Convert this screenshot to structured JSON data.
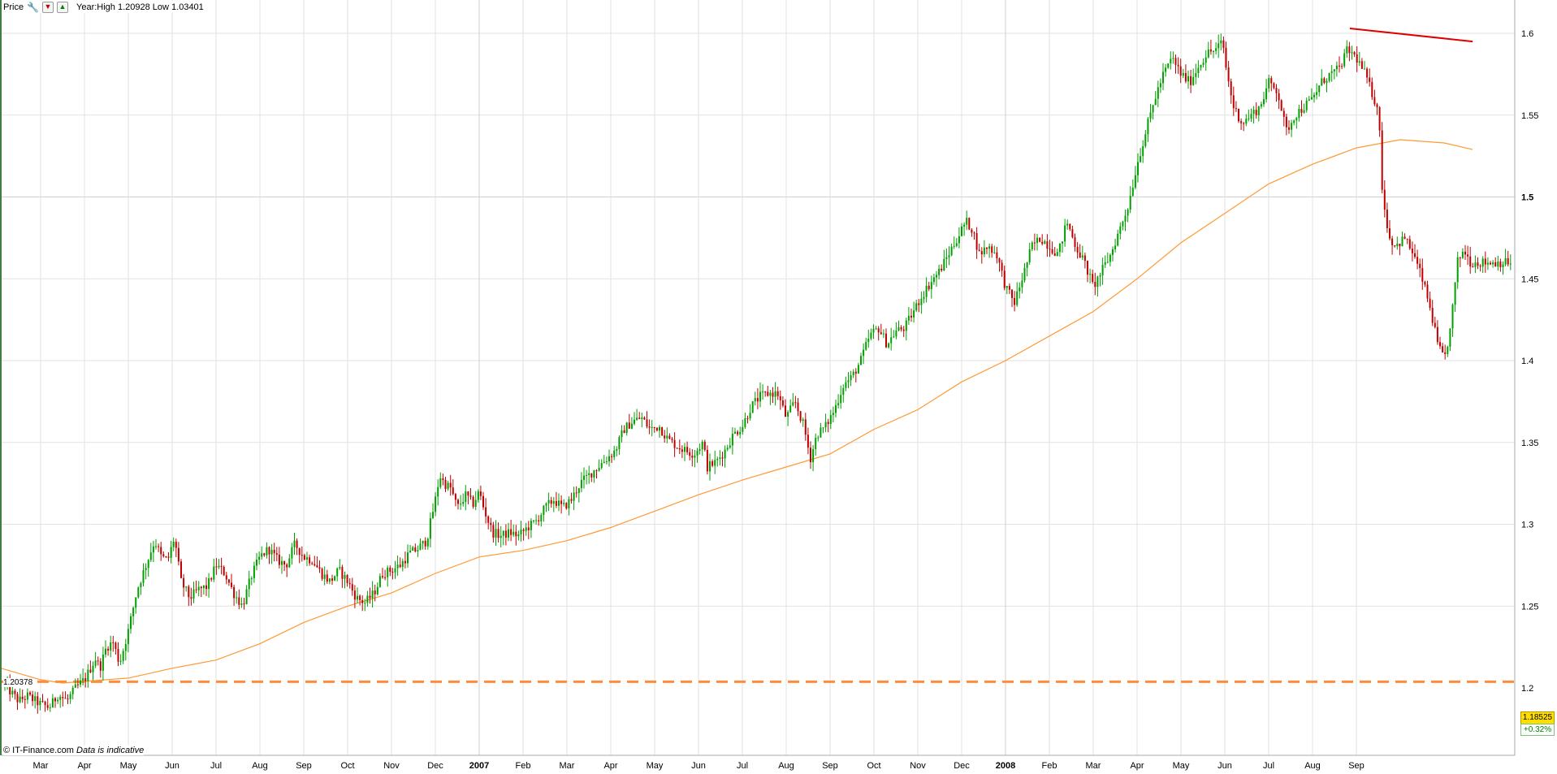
{
  "toolbar": {
    "price_label": "Price",
    "year_range": "Year:High 1.20928 Low 1.03401"
  },
  "icons": [
    "wrench-icon",
    "arrow-down-icon",
    "arrow-up-icon"
  ],
  "footer": {
    "source": "© IT-Finance.com",
    "disclaimer": "Data is indicative"
  },
  "price_box": {
    "last": "1.18525",
    "change": "+0.32%"
  },
  "level_label": "1.20378",
  "colors": {
    "up_candle": "#00a000",
    "down_candle": "#c00000",
    "moving_average": "#ff9933",
    "trendline": "#e00000",
    "support_line": "#ff8c3a",
    "grid": "#e2e2e2"
  },
  "chart_data": {
    "type": "candlestick",
    "title": "",
    "xlabel": "",
    "ylabel": "",
    "ylim": [
      1.18,
      1.62
    ],
    "grid": true,
    "y_ticks": [
      1.25,
      1.3,
      1.35,
      1.4,
      1.45,
      1.5,
      1.55,
      1.6
    ],
    "y_tick_labels": [
      "1.25",
      "1.3",
      "1.35",
      "1.4",
      "1.45",
      "1.5",
      "1.55",
      "1.6"
    ],
    "y_ticks_extra": [
      1.2
    ],
    "y_ticks_extra_labels": [
      "1.2"
    ],
    "x_tick_labels": [
      "Mar",
      "Apr",
      "May",
      "Jun",
      "Jul",
      "Aug",
      "Sep",
      "Oct",
      "Nov",
      "Dec",
      "2007",
      "Feb",
      "Mar",
      "Apr",
      "May",
      "Jun",
      "Jul",
      "Aug",
      "Sep",
      "Oct",
      "Nov",
      "Dec",
      "2008",
      "Feb",
      "Mar",
      "Apr",
      "May",
      "Jun",
      "Jul",
      "Aug",
      "Sep"
    ],
    "x_tick_bold": [
      false,
      false,
      false,
      false,
      false,
      false,
      false,
      false,
      false,
      false,
      true,
      false,
      false,
      false,
      false,
      false,
      false,
      false,
      false,
      false,
      false,
      false,
      true,
      false,
      false,
      false,
      false,
      false,
      false,
      false,
      false
    ],
    "x_tick_months": [
      0,
      1,
      2,
      3,
      4,
      5,
      6,
      7,
      8,
      9,
      10,
      11,
      12,
      13,
      14,
      15,
      16,
      17,
      18,
      19,
      20,
      21,
      22,
      23,
      24,
      25,
      26,
      27,
      28,
      29,
      30
    ],
    "x_range_months": [
      -0.9,
      30.65
    ],
    "price_path": [
      [
        -0.9,
        1.205
      ],
      [
        -0.7,
        1.198
      ],
      [
        -0.5,
        1.192
      ],
      [
        -0.3,
        1.195
      ],
      [
        0.0,
        1.19
      ],
      [
        0.2,
        1.188
      ],
      [
        0.4,
        1.196
      ],
      [
        0.6,
        1.192
      ],
      [
        0.8,
        1.2
      ],
      [
        1.0,
        1.205
      ],
      [
        1.1,
        1.21
      ],
      [
        1.25,
        1.218
      ],
      [
        1.35,
        1.212
      ],
      [
        1.5,
        1.225
      ],
      [
        1.65,
        1.228
      ],
      [
        1.8,
        1.215
      ],
      [
        2.0,
        1.235
      ],
      [
        2.2,
        1.26
      ],
      [
        2.4,
        1.275
      ],
      [
        2.6,
        1.29
      ],
      [
        2.75,
        1.28
      ],
      [
        2.9,
        1.278
      ],
      [
        3.05,
        1.292
      ],
      [
        3.2,
        1.265
      ],
      [
        3.4,
        1.255
      ],
      [
        3.6,
        1.26
      ],
      [
        3.8,
        1.262
      ],
      [
        4.0,
        1.275
      ],
      [
        4.2,
        1.27
      ],
      [
        4.4,
        1.258
      ],
      [
        4.6,
        1.25
      ],
      [
        4.8,
        1.268
      ],
      [
        5.0,
        1.28
      ],
      [
        5.2,
        1.285
      ],
      [
        5.4,
        1.278
      ],
      [
        5.6,
        1.275
      ],
      [
        5.8,
        1.288
      ],
      [
        6.0,
        1.28
      ],
      [
        6.2,
        1.278
      ],
      [
        6.4,
        1.27
      ],
      [
        6.6,
        1.265
      ],
      [
        6.8,
        1.272
      ],
      [
        7.0,
        1.265
      ],
      [
        7.2,
        1.255
      ],
      [
        7.4,
        1.252
      ],
      [
        7.6,
        1.258
      ],
      [
        7.8,
        1.27
      ],
      [
        8.0,
        1.272
      ],
      [
        8.2,
        1.275
      ],
      [
        8.4,
        1.282
      ],
      [
        8.6,
        1.285
      ],
      [
        8.8,
        1.29
      ],
      [
        9.0,
        1.315
      ],
      [
        9.1,
        1.33
      ],
      [
        9.2,
        1.325
      ],
      [
        9.35,
        1.322
      ],
      [
        9.5,
        1.31
      ],
      [
        9.7,
        1.318
      ],
      [
        9.85,
        1.312
      ],
      [
        10.0,
        1.32
      ],
      [
        10.1,
        1.31
      ],
      [
        10.3,
        1.295
      ],
      [
        10.5,
        1.293
      ],
      [
        10.7,
        1.295
      ],
      [
        10.9,
        1.293
      ],
      [
        11.1,
        1.298
      ],
      [
        11.3,
        1.302
      ],
      [
        11.5,
        1.31
      ],
      [
        11.7,
        1.315
      ],
      [
        11.9,
        1.31
      ],
      [
        12.1,
        1.315
      ],
      [
        12.3,
        1.325
      ],
      [
        12.5,
        1.33
      ],
      [
        12.7,
        1.335
      ],
      [
        12.9,
        1.34
      ],
      [
        13.1,
        1.345
      ],
      [
        13.3,
        1.358
      ],
      [
        13.5,
        1.363
      ],
      [
        13.7,
        1.365
      ],
      [
        13.9,
        1.358
      ],
      [
        14.1,
        1.36
      ],
      [
        14.3,
        1.352
      ],
      [
        14.5,
        1.348
      ],
      [
        14.7,
        1.345
      ],
      [
        14.9,
        1.343
      ],
      [
        15.1,
        1.35
      ],
      [
        15.2,
        1.335
      ],
      [
        15.4,
        1.338
      ],
      [
        15.6,
        1.345
      ],
      [
        15.8,
        1.355
      ],
      [
        16.0,
        1.36
      ],
      [
        16.2,
        1.372
      ],
      [
        16.4,
        1.378
      ],
      [
        16.6,
        1.38
      ],
      [
        16.8,
        1.38
      ],
      [
        17.0,
        1.365
      ],
      [
        17.2,
        1.375
      ],
      [
        17.4,
        1.36
      ],
      [
        17.55,
        1.34
      ],
      [
        17.7,
        1.355
      ],
      [
        17.9,
        1.36
      ],
      [
        18.1,
        1.37
      ],
      [
        18.3,
        1.385
      ],
      [
        18.5,
        1.39
      ],
      [
        18.7,
        1.4
      ],
      [
        18.9,
        1.415
      ],
      [
        19.1,
        1.42
      ],
      [
        19.3,
        1.41
      ],
      [
        19.5,
        1.418
      ],
      [
        19.7,
        1.42
      ],
      [
        19.9,
        1.43
      ],
      [
        20.1,
        1.44
      ],
      [
        20.3,
        1.448
      ],
      [
        20.5,
        1.455
      ],
      [
        20.7,
        1.465
      ],
      [
        20.9,
        1.475
      ],
      [
        21.1,
        1.485
      ],
      [
        21.25,
        1.48
      ],
      [
        21.4,
        1.465
      ],
      [
        21.6,
        1.47
      ],
      [
        21.8,
        1.465
      ],
      [
        22.0,
        1.445
      ],
      [
        22.2,
        1.435
      ],
      [
        22.4,
        1.452
      ],
      [
        22.6,
        1.47
      ],
      [
        22.8,
        1.475
      ],
      [
        23.0,
        1.47
      ],
      [
        23.2,
        1.465
      ],
      [
        23.4,
        1.485
      ],
      [
        23.6,
        1.47
      ],
      [
        23.8,
        1.46
      ],
      [
        24.0,
        1.445
      ],
      [
        24.2,
        1.455
      ],
      [
        24.4,
        1.465
      ],
      [
        24.6,
        1.48
      ],
      [
        24.8,
        1.495
      ],
      [
        25.0,
        1.52
      ],
      [
        25.2,
        1.54
      ],
      [
        25.4,
        1.56
      ],
      [
        25.6,
        1.575
      ],
      [
        25.8,
        1.585
      ],
      [
        26.0,
        1.575
      ],
      [
        26.2,
        1.57
      ],
      [
        26.4,
        1.58
      ],
      [
        26.6,
        1.588
      ],
      [
        26.8,
        1.59
      ],
      [
        26.95,
        1.595
      ],
      [
        27.05,
        1.575
      ],
      [
        27.2,
        1.555
      ],
      [
        27.4,
        1.545
      ],
      [
        27.6,
        1.55
      ],
      [
        27.8,
        1.555
      ],
      [
        28.0,
        1.57
      ],
      [
        28.2,
        1.565
      ],
      [
        28.4,
        1.54
      ],
      [
        28.6,
        1.55
      ],
      [
        28.8,
        1.555
      ],
      [
        29.0,
        1.56
      ],
      [
        29.2,
        1.57
      ],
      [
        29.4,
        1.575
      ],
      [
        29.6,
        1.578
      ],
      [
        29.8,
        1.59
      ],
      [
        30.0,
        1.585
      ],
      [
        30.2,
        1.575
      ],
      [
        30.4,
        1.56
      ],
      [
        30.5,
        1.555
      ],
      [
        30.6,
        1.5
      ],
      [
        30.75,
        1.475
      ],
      [
        30.9,
        1.47
      ],
      [
        31.1,
        1.475
      ],
      [
        31.3,
        1.465
      ],
      [
        31.5,
        1.45
      ],
      [
        31.7,
        1.43
      ],
      [
        31.85,
        1.41
      ],
      [
        32.0,
        1.4
      ],
      [
        32.15,
        1.42
      ],
      [
        32.3,
        1.46
      ],
      [
        32.45,
        1.468
      ],
      [
        32.6,
        1.46
      ]
    ],
    "moving_average": {
      "points": [
        [
          -0.9,
          1.212
        ],
        [
          0.0,
          1.205
        ],
        [
          0.5,
          1.203
        ],
        [
          1.0,
          1.204
        ],
        [
          2.0,
          1.206
        ],
        [
          3.0,
          1.212
        ],
        [
          4.0,
          1.217
        ],
        [
          5.0,
          1.227
        ],
        [
          6.0,
          1.24
        ],
        [
          7.0,
          1.25
        ],
        [
          8.0,
          1.258
        ],
        [
          9.0,
          1.27
        ],
        [
          10.0,
          1.28
        ],
        [
          11.0,
          1.284
        ],
        [
          12.0,
          1.29
        ],
        [
          13.0,
          1.298
        ],
        [
          14.0,
          1.308
        ],
        [
          15.0,
          1.318
        ],
        [
          16.0,
          1.327
        ],
        [
          17.0,
          1.335
        ],
        [
          18.0,
          1.343
        ],
        [
          19.0,
          1.358
        ],
        [
          20.0,
          1.37
        ],
        [
          21.0,
          1.387
        ],
        [
          22.0,
          1.4
        ],
        [
          23.0,
          1.415
        ],
        [
          24.0,
          1.43
        ],
        [
          25.0,
          1.45
        ],
        [
          26.0,
          1.472
        ],
        [
          27.0,
          1.49
        ],
        [
          28.0,
          1.508
        ],
        [
          29.0,
          1.52
        ],
        [
          30.0,
          1.53
        ],
        [
          31.0,
          1.535
        ],
        [
          32.0,
          1.533
        ],
        [
          32.65,
          1.529
        ]
      ]
    },
    "trendline": {
      "points": [
        [
          29.85,
          1.603
        ],
        [
          32.65,
          1.595
        ]
      ]
    },
    "support_line": {
      "value": 1.20378,
      "label": "1.20378"
    }
  }
}
